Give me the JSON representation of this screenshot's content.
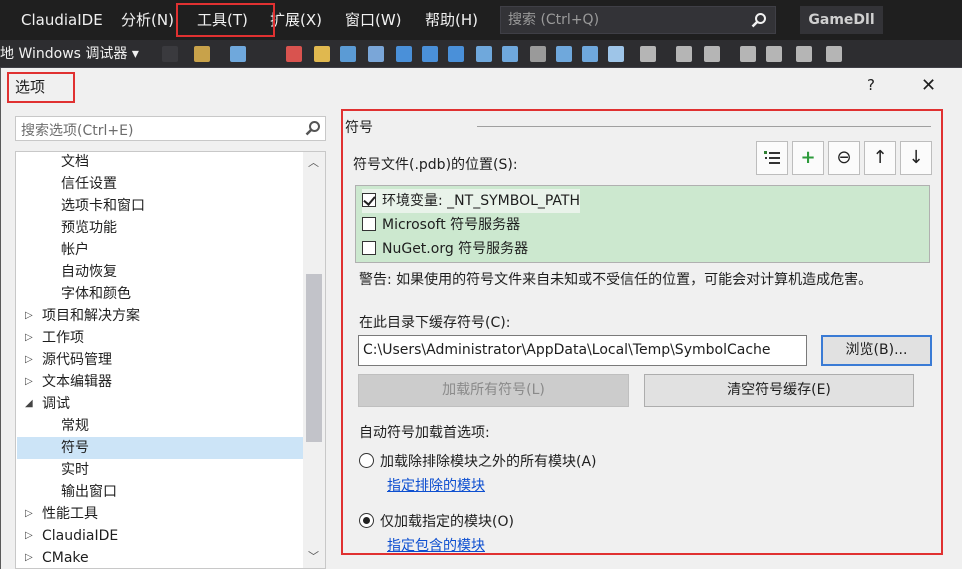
{
  "menubar": {
    "app_name": "ClaudiaIDE",
    "items": [
      "分析(N)",
      "工具(T)",
      "扩展(X)",
      "窗口(W)",
      "帮助(H)"
    ],
    "search_placeholder": "搜索 (Ctrl+Q)",
    "solution_name": "GameDll"
  },
  "toolbar": {
    "debugger_label": "地 Windows 调试器 ▾"
  },
  "dialog": {
    "title": "选项",
    "help_glyph": "?",
    "close_glyph": "✕",
    "search_placeholder": "搜索选项(Ctrl+E)",
    "tree": [
      {
        "label": "文档",
        "level": 1,
        "arrow": ""
      },
      {
        "label": "信任设置",
        "level": 1,
        "arrow": ""
      },
      {
        "label": "选项卡和窗口",
        "level": 1,
        "arrow": ""
      },
      {
        "label": "预览功能",
        "level": 1,
        "arrow": ""
      },
      {
        "label": "帐户",
        "level": 1,
        "arrow": ""
      },
      {
        "label": "自动恢复",
        "level": 1,
        "arrow": ""
      },
      {
        "label": "字体和颜色",
        "level": 1,
        "arrow": ""
      },
      {
        "label": "项目和解决方案",
        "level": 0,
        "arrow": "▷"
      },
      {
        "label": "工作项",
        "level": 0,
        "arrow": "▷"
      },
      {
        "label": "源代码管理",
        "level": 0,
        "arrow": "▷"
      },
      {
        "label": "文本编辑器",
        "level": 0,
        "arrow": "▷"
      },
      {
        "label": "调试",
        "level": 0,
        "arrow": "◢"
      },
      {
        "label": "常规",
        "level": 1,
        "arrow": ""
      },
      {
        "label": "符号",
        "level": 1,
        "arrow": "",
        "selected": true
      },
      {
        "label": "实时",
        "level": 1,
        "arrow": ""
      },
      {
        "label": "输出窗口",
        "level": 1,
        "arrow": ""
      },
      {
        "label": "性能工具",
        "level": 0,
        "arrow": "▷"
      },
      {
        "label": "ClaudiaIDE",
        "level": 0,
        "arrow": "▷"
      },
      {
        "label": "CMake",
        "level": 0,
        "arrow": "▷"
      }
    ],
    "panel": {
      "section_title": "符号",
      "symbol_locations_label": "符号文件(.pdb)的位置(S):",
      "symbol_locations": [
        {
          "label": "环境变量: _NT_SYMBOL_PATH",
          "checked": true
        },
        {
          "label": "Microsoft 符号服务器",
          "checked": false
        },
        {
          "label": "NuGet.org 符号服务器",
          "checked": false
        }
      ],
      "warning": "警告: 如果使用的符号文件来自未知或不受信任的位置，可能会对计算机造成危害。",
      "cache_label": "在此目录下缓存符号(C):",
      "cache_path": "C:\\Users\\Administrator\\AppData\\Local\\Temp\\SymbolCache",
      "browse_label": "浏览(B)...",
      "load_all_label": "加载所有符号(L)",
      "clear_cache_label": "清空符号缓存(E)",
      "auto_load_label": "自动符号加载首选项:",
      "radio_all_label": "加载除排除模块之外的所有模块(A)",
      "link_excluded": "指定排除的模块",
      "radio_specified_label": "仅加载指定的模块(O)",
      "link_included": "指定包含的模块",
      "selected_radio": "specified"
    }
  },
  "colors": {
    "highlight_red": "#e03131",
    "list_green": "#cce8cf",
    "link_blue": "#0e4fd0",
    "tree_selected": "#cce4f7"
  }
}
